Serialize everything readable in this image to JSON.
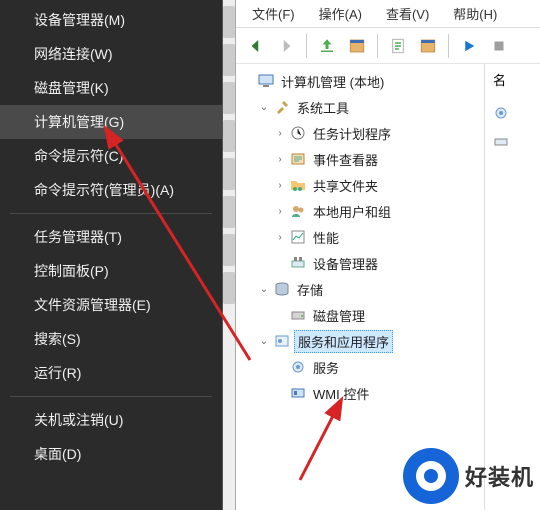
{
  "context_menu": {
    "items": [
      "设备管理器(M)",
      "网络连接(W)",
      "磁盘管理(K)",
      "计算机管理(G)",
      "命令提示符(C)",
      "命令提示符(管理员)(A)",
      "—",
      "任务管理器(T)",
      "控制面板(P)",
      "文件资源管理器(E)",
      "搜索(S)",
      "运行(R)",
      "—",
      "关机或注销(U)",
      "桌面(D)"
    ],
    "highlighted_index": 3
  },
  "menubar": {
    "file": "文件(F)",
    "action": "操作(A)",
    "view": "查看(V)",
    "help": "帮助(H)"
  },
  "toolbar_icons": {
    "back": "back-arrow-icon",
    "forward": "forward-arrow-icon",
    "up": "up-icon",
    "view": "view-options-icon",
    "props": "properties-icon",
    "refresh": "refresh-icon",
    "export": "run-service-icon",
    "stop": "stop-service-icon"
  },
  "tree": {
    "root": "计算机管理 (本地)",
    "systools": "系统工具",
    "task_scheduler": "任务计划程序",
    "event_viewer": "事件查看器",
    "shared_folders": "共享文件夹",
    "local_users_groups": "本地用户和组",
    "performance": "性能",
    "device_manager": "设备管理器",
    "storage": "存储",
    "disk_mgmt": "磁盘管理",
    "services_apps": "服务和应用程序",
    "services": "服务",
    "wmi_control": "WMI 控件"
  },
  "actions_pane": {
    "header": "名",
    "gear_row": "",
    "more_row": ""
  },
  "brand": {
    "text": "好装机"
  }
}
